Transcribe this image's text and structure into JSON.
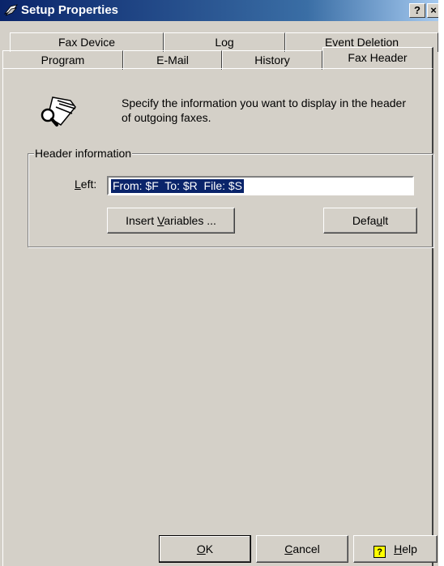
{
  "window": {
    "title": "Setup Properties",
    "help_button": "?",
    "close_button": "×"
  },
  "tabs_back": [
    {
      "label": "Fax Device"
    },
    {
      "label": "Log"
    },
    {
      "label": "Event Deletion"
    }
  ],
  "tabs_front": [
    {
      "label": "Program"
    },
    {
      "label": "E-Mail"
    },
    {
      "label": "History"
    },
    {
      "label": "Fax Header"
    }
  ],
  "description": "Specify the information you want to display in the header of outgoing faxes.",
  "group": {
    "legend": "Header information",
    "left_label_char": "L",
    "left_label_rest": "eft:",
    "left_value": "From: $F  To: $R  File: $S"
  },
  "buttons": {
    "insert_a": "Insert ",
    "insert_u": "V",
    "insert_b": "ariables ...",
    "default_a": "Defa",
    "default_u": "u",
    "default_b": "lt",
    "ok_u": "O",
    "ok_rest": "K",
    "cancel_u": "C",
    "cancel_rest": "ancel",
    "help_u": "H",
    "help_rest": "elp",
    "help_icon_glyph": "?"
  }
}
